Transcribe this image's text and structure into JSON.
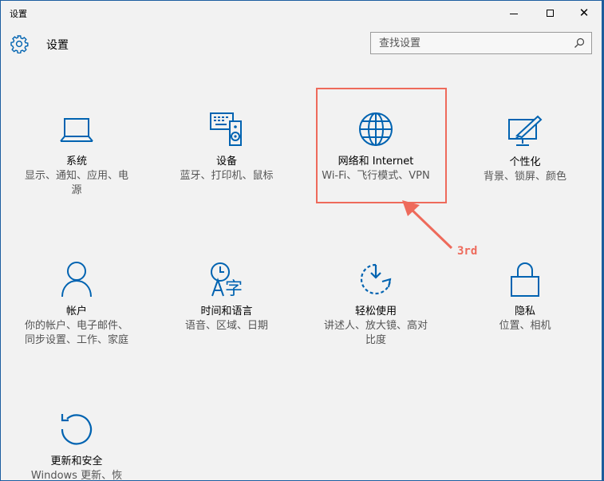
{
  "window": {
    "title": "设置",
    "controls": [
      "minimize",
      "maximize",
      "close"
    ]
  },
  "header": {
    "title": "设置",
    "icon": "gear-icon"
  },
  "search": {
    "placeholder": "查找设置",
    "value": "",
    "icon": "search-icon"
  },
  "tiles": [
    {
      "name": "系统",
      "desc_lines": [
        "显示、通知、应用、电",
        "源"
      ],
      "icon": "laptop-icon"
    },
    {
      "name": "设备",
      "desc_lines": [
        "蓝牙、打印机、鼠标"
      ],
      "icon": "devices-icon"
    },
    {
      "name": "网络和 Internet",
      "desc_lines": [
        "Wi-Fi、飞行模式、VPN"
      ],
      "icon": "globe-icon"
    },
    {
      "name": "个性化",
      "desc_lines": [
        "背景、锁屏、颜色"
      ],
      "icon": "personalization-icon"
    },
    {
      "name": "帐户",
      "desc_lines": [
        "你的帐户、电子邮件、",
        "同步设置、工作、家庭"
      ],
      "icon": "person-icon"
    },
    {
      "name": "时间和语言",
      "desc_lines": [
        "语音、区域、日期"
      ],
      "icon": "time-language-icon"
    },
    {
      "name": "轻松使用",
      "desc_lines": [
        "讲述人、放大镜、高对",
        "比度"
      ],
      "icon": "ease-of-access-icon"
    },
    {
      "name": "隐私",
      "desc_lines": [
        "位置、相机"
      ],
      "icon": "lock-icon"
    },
    {
      "name": "更新和安全",
      "desc_lines": [
        "Windows 更新、恢"
      ],
      "icon": "update-icon"
    }
  ],
  "annotation": {
    "label": "3rd",
    "target": "网络和 Internet",
    "color": "#ee6a5b"
  },
  "colors": {
    "accent": "#0063b1",
    "window_bg": "#f2f2f2",
    "desktop": "#1e5c9a"
  }
}
